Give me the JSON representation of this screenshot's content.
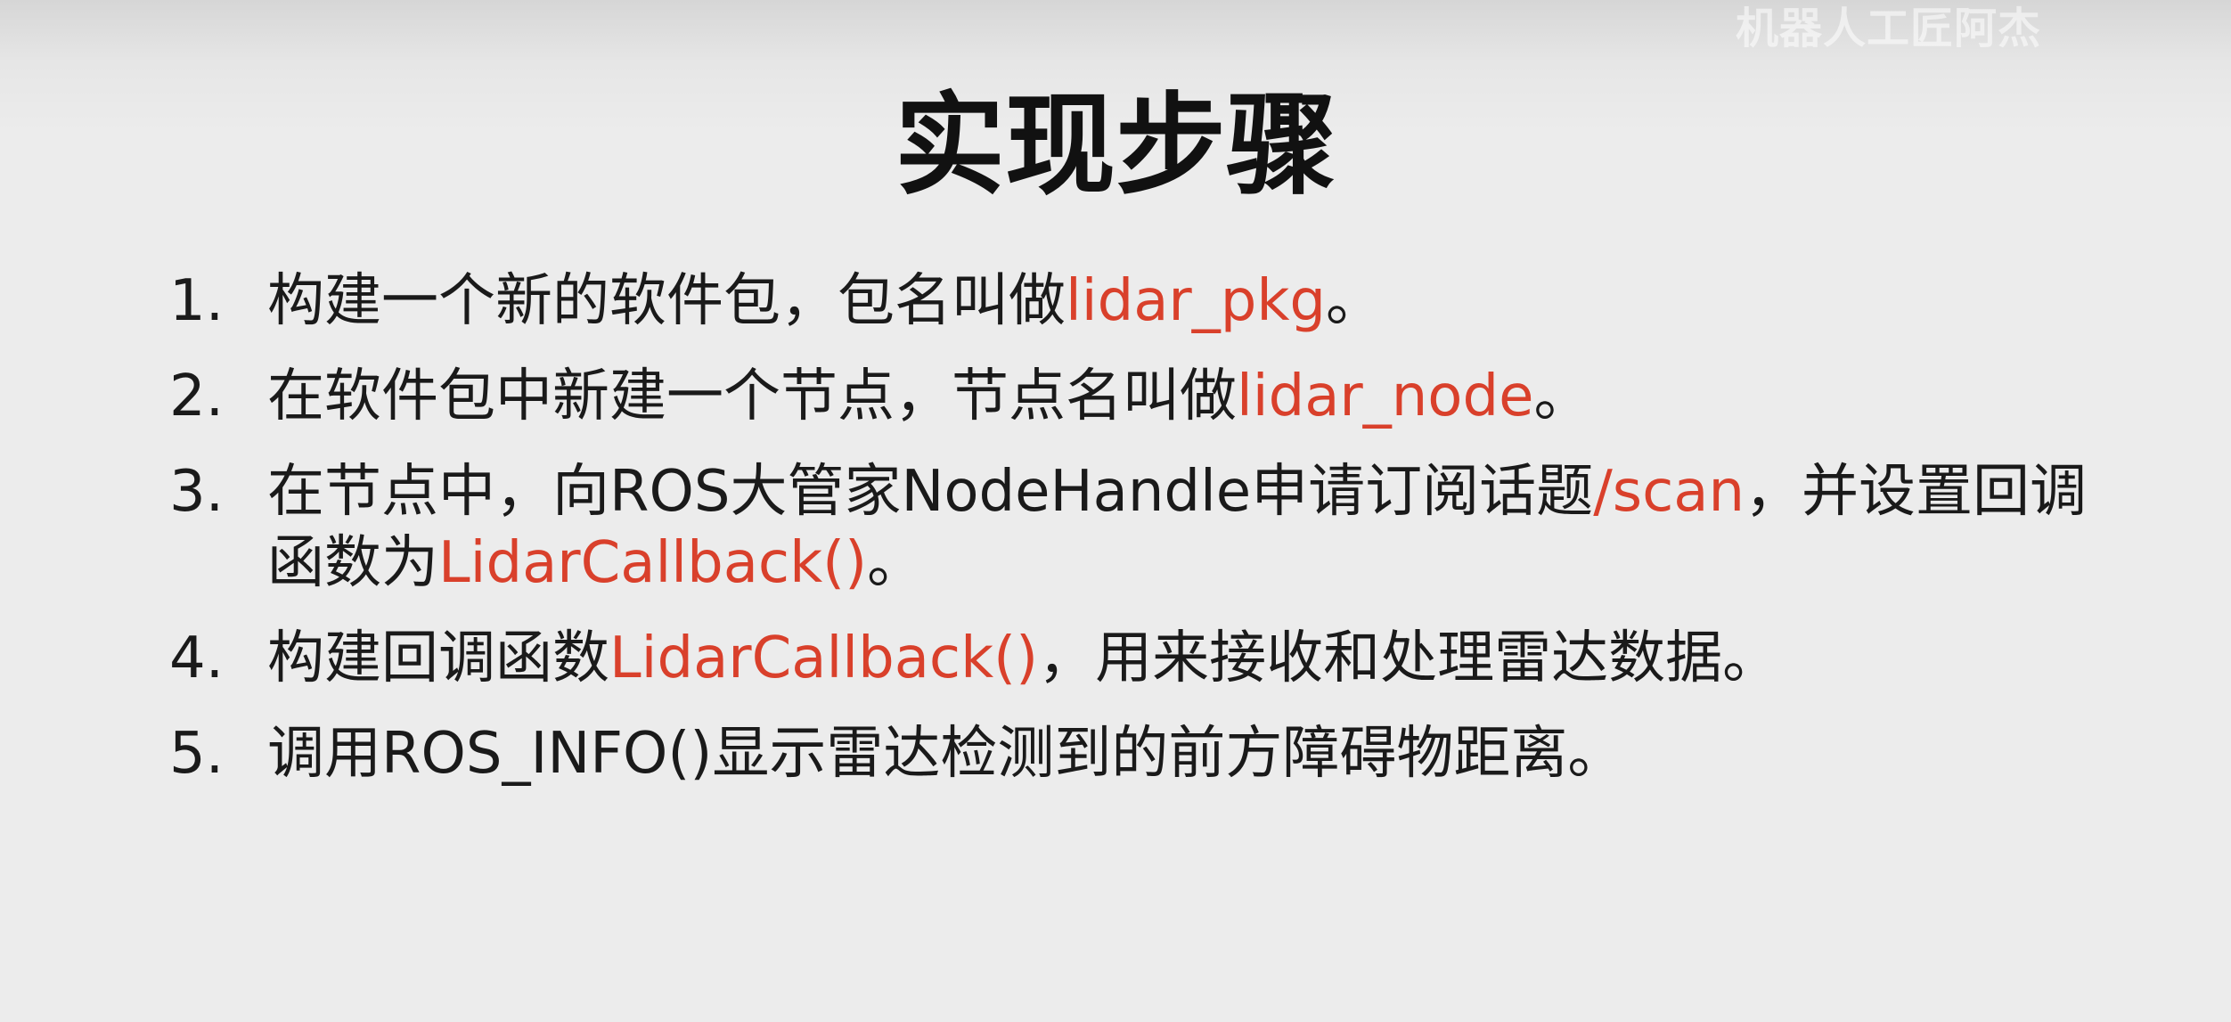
{
  "watermark": "机器人工匠阿杰",
  "title": "实现步骤",
  "highlight_color": "#d9402b",
  "steps": [
    {
      "number": "1.",
      "text_before": "构建一个新的软件包，包名叫做",
      "highlight": "lidar_pkg",
      "text_middle": "。",
      "highlight2": "",
      "text_after": ""
    },
    {
      "number": "2.",
      "text_before": "在软件包中新建一个节点，节点名叫做",
      "highlight": "lidar_node",
      "text_middle": "。",
      "highlight2": "",
      "text_after": ""
    },
    {
      "number": "3.",
      "text_before": "在节点中，向ROS大管家NodeHandle申请订阅话题",
      "highlight": "/scan",
      "text_middle": "，并设置回调函数为",
      "highlight2": "LidarCallback()",
      "text_after": "。"
    },
    {
      "number": "4.",
      "text_before": "构建回调函数",
      "highlight": "LidarCallback()",
      "text_middle": "，用来接收和处理雷达数据。",
      "highlight2": "",
      "text_after": ""
    },
    {
      "number": "5.",
      "text_before": "调用ROS_INFO()显示雷达检测到的前方障碍物距离。",
      "highlight": "",
      "text_middle": "",
      "highlight2": "",
      "text_after": ""
    }
  ]
}
